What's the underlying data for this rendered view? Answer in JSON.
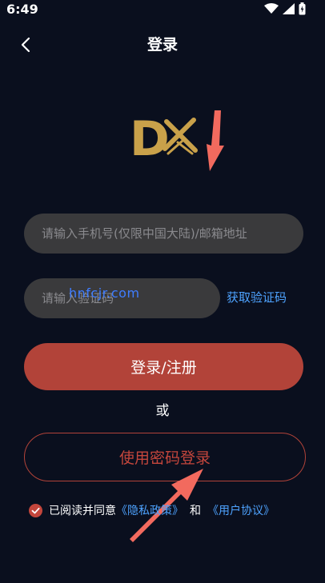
{
  "status_bar": {
    "time": "6:49",
    "icons": [
      "wifi-icon",
      "cell-signal-icon",
      "battery-icon"
    ]
  },
  "nav": {
    "title": "登录",
    "back_icon": "chevron-left-icon"
  },
  "logo": {
    "letter": "D",
    "icon": "crossed-swords-icon",
    "color": "#c9a14a"
  },
  "form": {
    "phone_placeholder": "请输入手机号(仅限中国大陆)/邮箱地址",
    "code_placeholder": "请输入验证码",
    "get_code_label": "获取验证码",
    "login_label": "登录/注册",
    "or_label": "或",
    "password_login_label": "使用密码登录"
  },
  "agreement": {
    "prefix": "已阅读并同意",
    "privacy_label": "《隐私政策》",
    "and_label": "和",
    "terms_label": "《用户协议》",
    "checked": true
  },
  "watermark": "hnfcjr.com",
  "colors": {
    "background": "#0a0f1e",
    "accent": "#b24339",
    "link": "#4ea3ff",
    "input_bg": "#3a3a3c",
    "annotation": "#f26a5e"
  }
}
